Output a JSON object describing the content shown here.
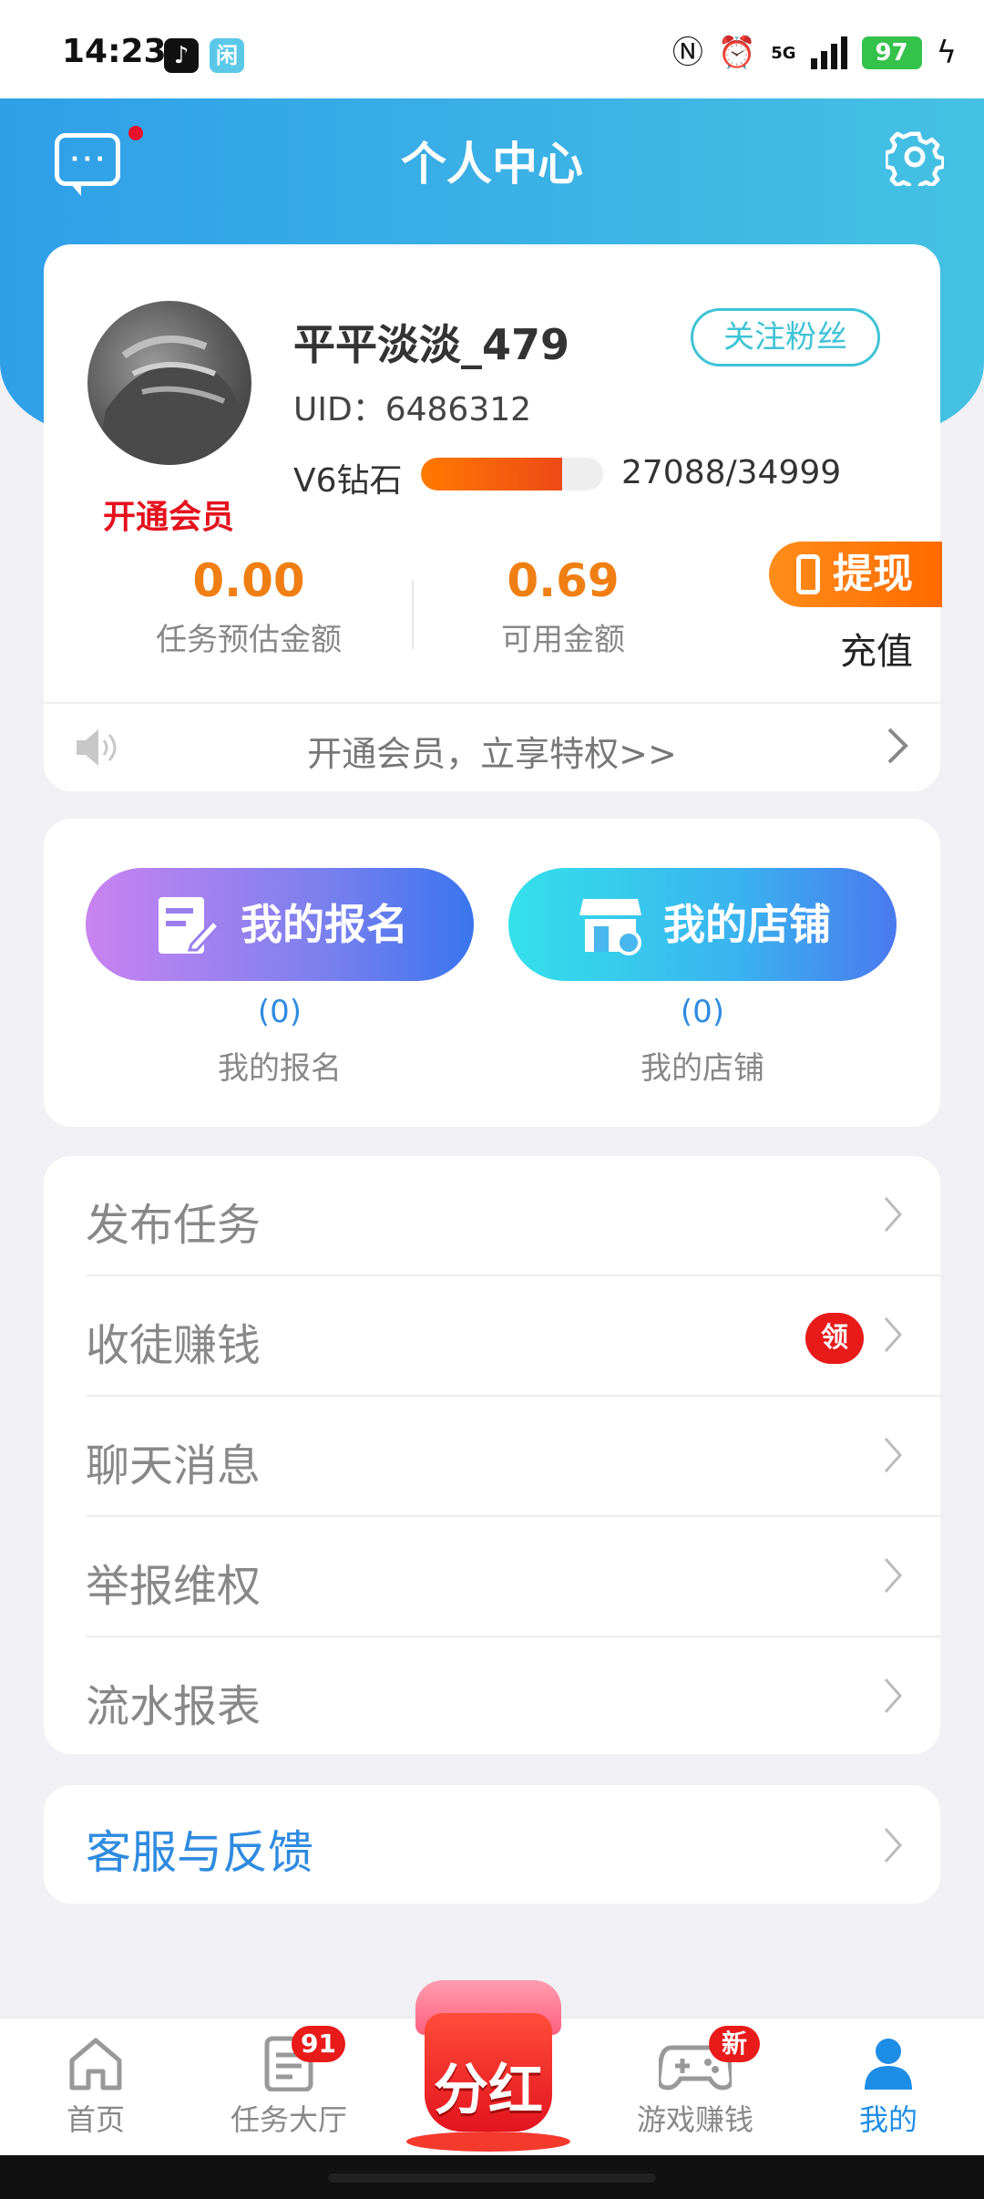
{
  "status_bar": {
    "time": "14:23",
    "app1_icon": "tiktok-icon",
    "app2_label": "闲",
    "battery": "97",
    "network": "5G"
  },
  "header": {
    "title": "个人中心",
    "message_icon": "chat-bubble-icon",
    "settings_icon": "gear-icon",
    "unread_dot_color": "#e8102a"
  },
  "profile": {
    "nickname": "平平淡淡_479",
    "follow_fans_label": "关注粉丝",
    "uid_label": "UID：",
    "uid_value": "6486312",
    "level_name": "V6钻石",
    "level_progress": "27088/34999",
    "level_fraction": 0.774,
    "vip_link": "开通会员",
    "task_amount_value": "0.00",
    "task_amount_label": "任务预估金额",
    "available_amount_value": "0.69",
    "available_amount_label": "可用金额",
    "withdraw_label": "提现",
    "recharge_label": "充值",
    "promo_text": "开通会员，立享特权>>"
  },
  "shortcuts": [
    {
      "button_label": "我的报名",
      "count": "(0)",
      "caption": "我的报名",
      "icon": "edit-form-icon"
    },
    {
      "button_label": "我的店铺",
      "count": "(0)",
      "caption": "我的店铺",
      "icon": "store-icon"
    }
  ],
  "menu": [
    {
      "label": "发布任务"
    },
    {
      "label": "收徒赚钱",
      "badge": "领"
    },
    {
      "label": "聊天消息"
    },
    {
      "label": "举报维权"
    },
    {
      "label": "流水报表"
    }
  ],
  "support": {
    "label": "客服与反馈"
  },
  "tabbar": {
    "items": [
      {
        "label": "首页",
        "icon": "home-icon"
      },
      {
        "label": "任务大厅",
        "icon": "task-list-icon",
        "badge": "91"
      },
      {
        "label": "分红",
        "icon": "red-packet-icon"
      },
      {
        "label": "游戏赚钱",
        "icon": "gamepad-icon",
        "badge": "新"
      },
      {
        "label": "我的",
        "icon": "user-icon",
        "active": true
      }
    ]
  },
  "colors": {
    "accent_blue": "#2f9fe8",
    "amount_orange": "#f07f13",
    "vip_red": "#e4121e",
    "active_tab": "#1e8de6"
  }
}
